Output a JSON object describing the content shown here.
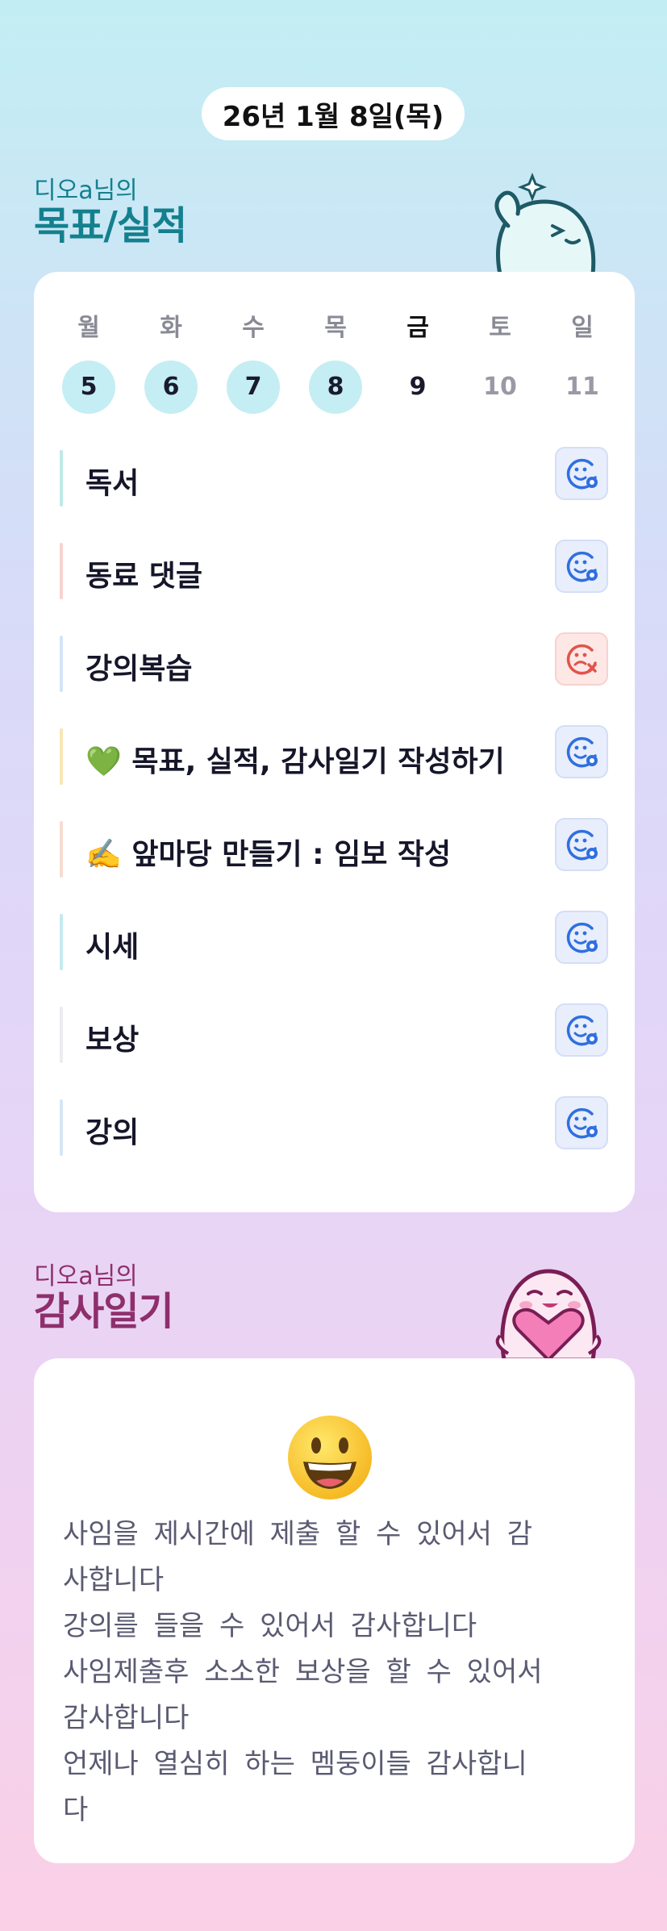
{
  "date": "26년 1월 8일(목)",
  "goals_section": {
    "owner": "디오a님의",
    "title": "목표/실적"
  },
  "week": [
    {
      "dow": "월",
      "num": "5",
      "state": "done"
    },
    {
      "dow": "화",
      "num": "6",
      "state": "done"
    },
    {
      "dow": "수",
      "num": "7",
      "state": "done"
    },
    {
      "dow": "목",
      "num": "8",
      "state": "done"
    },
    {
      "dow": "금",
      "num": "9",
      "state": "today"
    },
    {
      "dow": "토",
      "num": "10",
      "state": "future"
    },
    {
      "dow": "일",
      "num": "11",
      "state": "future"
    }
  ],
  "goals": [
    {
      "label": "독서",
      "bar_color": "#bfeae6",
      "status": "ok",
      "icon": "smile-check-icon"
    },
    {
      "label": "동료 댓글",
      "bar_color": "#f8d3d0",
      "status": "ok",
      "icon": "smile-check-icon"
    },
    {
      "label": "강의복습",
      "bar_color": "#d4e4f6",
      "status": "fail",
      "icon": "sad-x-icon"
    },
    {
      "label": "💚 목표, 실적, 감사일기 작성하기",
      "bar_color": "#f9e6b8",
      "status": "ok",
      "icon": "smile-check-icon"
    },
    {
      "label": "✍️ 앞마당 만들기 : 임보 작성",
      "bar_color": "#f7dcd0",
      "status": "ok",
      "icon": "smile-check-icon"
    },
    {
      "label": "시세",
      "bar_color": "#c4eaf0",
      "status": "ok",
      "icon": "smile-check-icon"
    },
    {
      "label": "보상",
      "bar_color": "#ececf0",
      "status": "ok",
      "icon": "smile-check-icon"
    },
    {
      "label": "강의",
      "bar_color": "#d6e6f4",
      "status": "ok",
      "icon": "smile-check-icon"
    }
  ],
  "thanks_section": {
    "owner": "디오a님의",
    "title": "감사일기"
  },
  "thanks": {
    "emoji": "grinning-face-icon",
    "lines": [
      "사임을 제시간에 제출 할 수 있어서 감",
      "사합니다",
      "강의를 들을 수 있어서 감사합니다",
      "사임제출후 소소한 보상을 할 수 있어서",
      "감사합니다",
      "언제나 열심히 하는  멤둥이들 감사합니",
      "다"
    ]
  },
  "colors": {
    "goals_title": "#14808e",
    "thanks_title": "#8e2f6c",
    "done_circle": "#c4eef3",
    "ok_icon": "#2f6fe0",
    "fail_icon": "#e2544a"
  }
}
